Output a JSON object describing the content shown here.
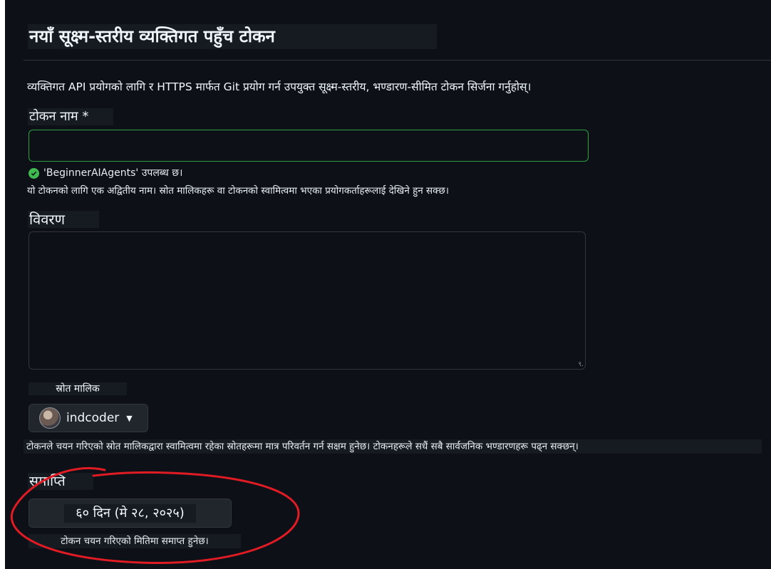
{
  "page": {
    "title": "नयाँ सूक्ष्म-स्तरीय व्यक्तिगत पहुँच टोकन",
    "description": "व्यक्तिगत API प्रयोगको लागि र HTTPS मार्फत Git प्रयोग गर्न उपयुक्त सूक्ष्म-स्तरीय, भण्डारण-सीमित टोकन सिर्जना गर्नुहोस्।"
  },
  "token_name": {
    "label": "टोकन नाम *",
    "value": "",
    "success_message": "'BeginnerAIAgents' उपलब्ध छ।",
    "help": "यो टोकनको लागि एक अद्वितीय नाम। स्रोत मालिकहरू वा टोकनको स्वामित्वमा भएका प्रयोगकर्ताहरूलाई देखिने हुन सक्छ।"
  },
  "description_field": {
    "label": "विवरण",
    "value": "",
    "resize_glyph": "९."
  },
  "resource_owner": {
    "label": "स्रोत मालिक",
    "selected": "indcoder",
    "help": "टोकनले चयन गरिएको स्रोत मालिकद्वारा स्वामित्वमा रहेका स्रोतहरूमा मात्र परिवर्तन गर्न सक्षम हुनेछ। टोकनहरूले सधैं सबै सार्वजनिक भण्डारणहरू पढ्न सक्छन्।"
  },
  "expiration": {
    "label": "समाप्ति",
    "selected": "६० दिन (मे २८, २०२५)",
    "help": "टोकन चयन गरिएको मितिमा समाप्त हुनेछ।"
  },
  "colors": {
    "background": "#0d1117",
    "success": "#3fb950",
    "annotation": "#e01b24"
  }
}
